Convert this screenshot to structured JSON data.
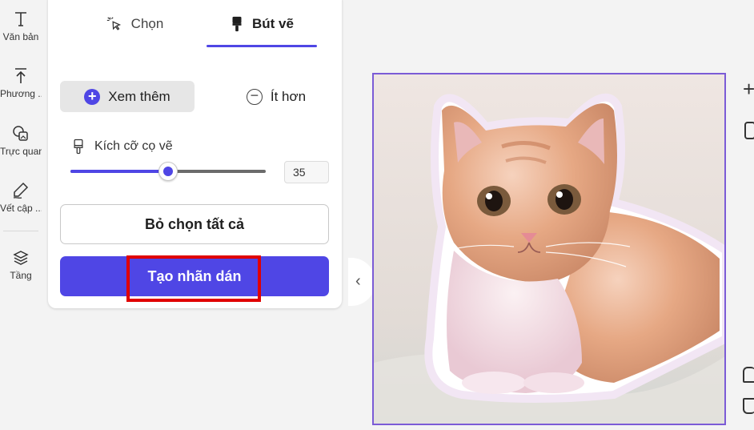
{
  "sidebar": {
    "items": [
      {
        "icon": "text-icon",
        "label": "Văn bản"
      },
      {
        "icon": "upload-icon",
        "label": "Phương ..."
      },
      {
        "icon": "shapes-icon",
        "label": "Trực quan"
      },
      {
        "icon": "pen-icon",
        "label": "Vết cập ..."
      },
      {
        "icon": "layers-icon",
        "label": "Tầng"
      }
    ]
  },
  "panel": {
    "tabs": [
      {
        "icon": "cursor-select-icon",
        "label": "Chọn"
      },
      {
        "icon": "brush-icon",
        "label": "Bút vẽ",
        "active": true
      }
    ],
    "more_label": "Xem thêm",
    "less_label": "Ít hơn",
    "brush_size_label": "Kích cỡ cọ vẽ",
    "brush_size_value": "35",
    "brush_size_fraction": 0.5,
    "deselect_label": "Bỏ chọn tất cả",
    "create_label": "Tạo nhãn dán"
  },
  "colors": {
    "accent": "#4f46e5",
    "highlight": "#e00000",
    "canvas_border": "#7b5bd6"
  },
  "canvas": {
    "image": "orange-kitten-sticker"
  }
}
